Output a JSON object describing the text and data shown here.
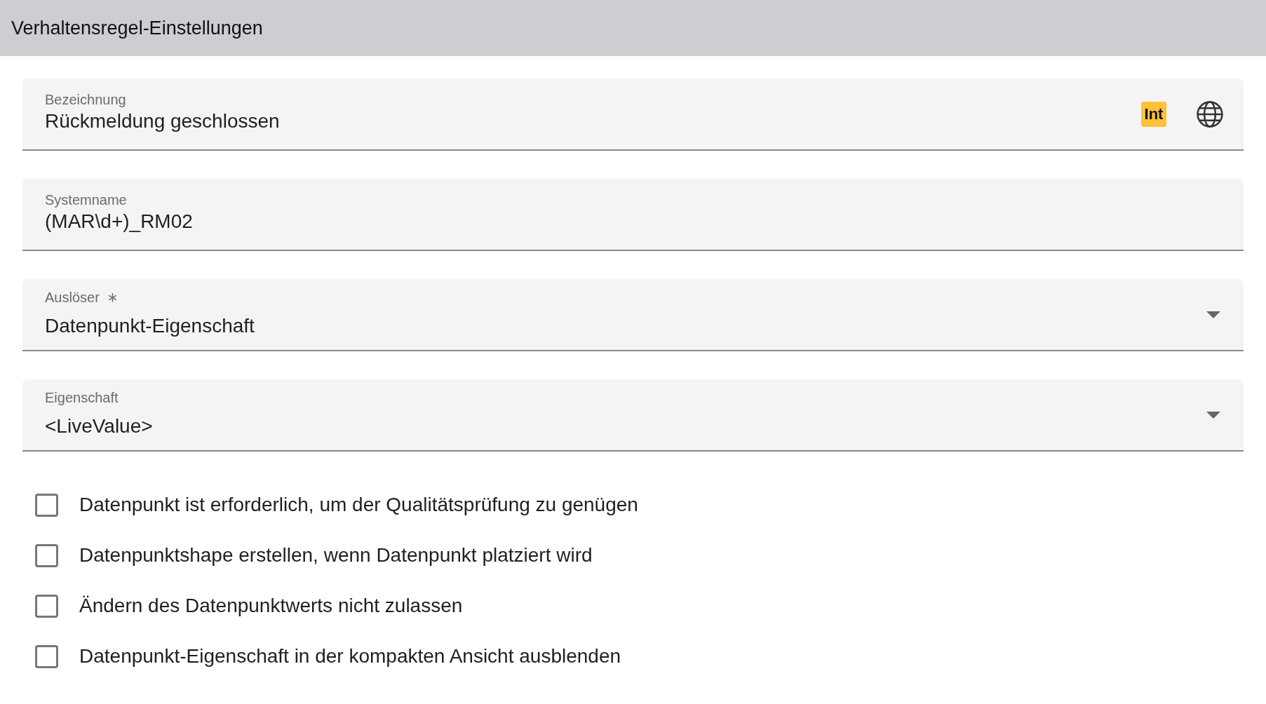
{
  "header": {
    "title": "Verhaltensregel-Einstellungen"
  },
  "fields": [
    {
      "kind": "localized",
      "label": "Bezeichnung",
      "value": "Rückmeldung geschlossen",
      "badge": "Int",
      "required": false
    },
    {
      "kind": "text",
      "label": "Systemname",
      "value": "(MAR\\d+)_RM02",
      "required": false
    },
    {
      "kind": "select",
      "label": "Auslöser",
      "value": "Datenpunkt-Eigenschaft",
      "required": true
    },
    {
      "kind": "select",
      "label": "Eigenschaft",
      "value": "<LiveValue>",
      "required": false
    }
  ],
  "checks": [
    {
      "label": "Datenpunkt ist erforderlich, um der Qualitätsprüfung zu genügen",
      "checked": false
    },
    {
      "label": "Datenpunktshape erstellen, wenn Datenpunkt platziert wird",
      "checked": false
    },
    {
      "label": "Ändern des Datenpunktwerts nicht zulassen",
      "checked": false
    },
    {
      "label": "Datenpunkt-Eigenschaft in der kompakten Ansicht ausblenden",
      "checked": false
    }
  ]
}
